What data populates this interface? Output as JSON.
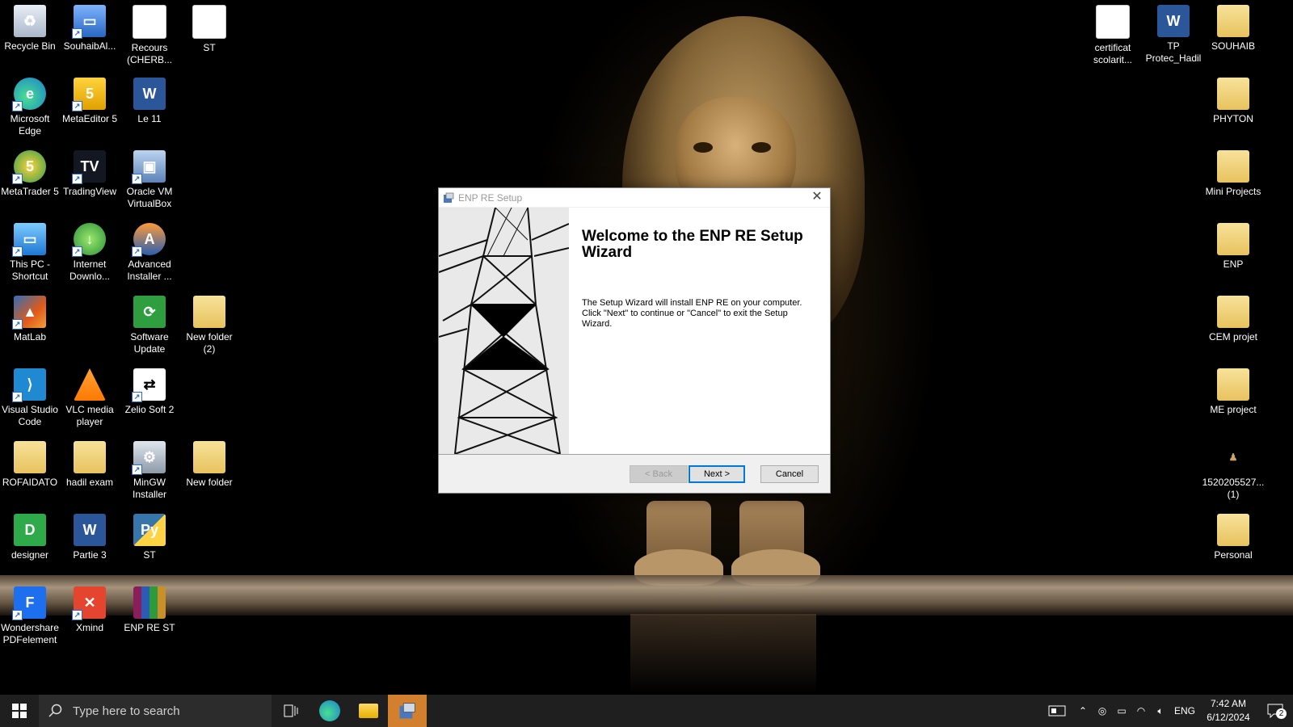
{
  "desktop_icons_left": [
    {
      "label": "Recycle Bin",
      "icon": "recycle-bin-icon"
    },
    {
      "label": "SouhaibAl...",
      "icon": "computer-icon"
    },
    {
      "label": "Recours (CHERB...",
      "icon": "document-icon"
    },
    {
      "label": "ST",
      "icon": "document-icon"
    },
    {
      "label": "Microsoft Edge",
      "icon": "edge-icon"
    },
    {
      "label": "MetaEditor 5",
      "icon": "metaeditor-icon"
    },
    {
      "label": "Le 11",
      "icon": "word-icon"
    },
    {
      "label": "MetaTrader 5",
      "icon": "metatrader-icon"
    },
    {
      "label": "TradingView",
      "icon": "tradingview-icon"
    },
    {
      "label": "Oracle VM VirtualBox",
      "icon": "virtualbox-icon"
    },
    {
      "label": "This PC - Shortcut",
      "icon": "this-pc-icon"
    },
    {
      "label": "Internet Downlo...",
      "icon": "idm-icon"
    },
    {
      "label": "Advanced Installer ...",
      "icon": "advanced-installer-icon"
    },
    {
      "label": "MatLab",
      "icon": "matlab-icon"
    },
    {
      "label": "Software Update",
      "icon": "software-update-icon"
    },
    {
      "label": "New folder (2)",
      "icon": "folder-icon"
    },
    {
      "label": "Visual Studio Code",
      "icon": "vscode-icon"
    },
    {
      "label": "VLC media player",
      "icon": "vlc-icon"
    },
    {
      "label": "Zelio Soft 2",
      "icon": "zelio-icon"
    },
    {
      "label": "ROFAIDATO",
      "icon": "folder-icon"
    },
    {
      "label": "hadil exam",
      "icon": "folder-icon"
    },
    {
      "label": "MinGW Installer",
      "icon": "mingw-icon"
    },
    {
      "label": "New folder",
      "icon": "folder-icon"
    },
    {
      "label": "designer",
      "icon": "designer-icon"
    },
    {
      "label": "Partie 3",
      "icon": "word-icon"
    },
    {
      "label": "ST",
      "icon": "python-icon"
    },
    {
      "label": "Wondershare PDFelement",
      "icon": "pdfelement-icon"
    },
    {
      "label": "Xmind",
      "icon": "xmind-icon"
    },
    {
      "label": "ENP RE ST",
      "icon": "winrar-icon"
    }
  ],
  "desktop_icons_right": [
    {
      "label": "certificat scolarit...",
      "icon": "document-icon"
    },
    {
      "label": "TP Protec_Hadil",
      "icon": "word-icon"
    },
    {
      "label": "SOUHAIB",
      "icon": "folder-icon"
    },
    {
      "label": "PHYTON",
      "icon": "folder-icon"
    },
    {
      "label": "Mini Projects",
      "icon": "folder-icon"
    },
    {
      "label": "ENP",
      "icon": "folder-icon"
    },
    {
      "label": "CEM projet",
      "icon": "folder-icon"
    },
    {
      "label": "ME project",
      "icon": "folder-icon"
    },
    {
      "label": "1520205527... (1)",
      "icon": "image-file-icon"
    },
    {
      "label": "Personal",
      "icon": "folder-icon"
    }
  ],
  "dialog": {
    "title": "ENP RE Setup",
    "heading": "Welcome to the ENP RE Setup Wizard",
    "description": "The Setup Wizard will install ENP RE on your computer.  Click \"Next\" to continue or \"Cancel\" to exit the Setup Wizard.",
    "back_label": "< Back",
    "next_label": "Next >",
    "cancel_label": "Cancel"
  },
  "taskbar": {
    "search_placeholder": "Type here to search",
    "language": "ENG",
    "time": "7:42 AM",
    "date": "6/12/2024",
    "notification_count": "2"
  }
}
